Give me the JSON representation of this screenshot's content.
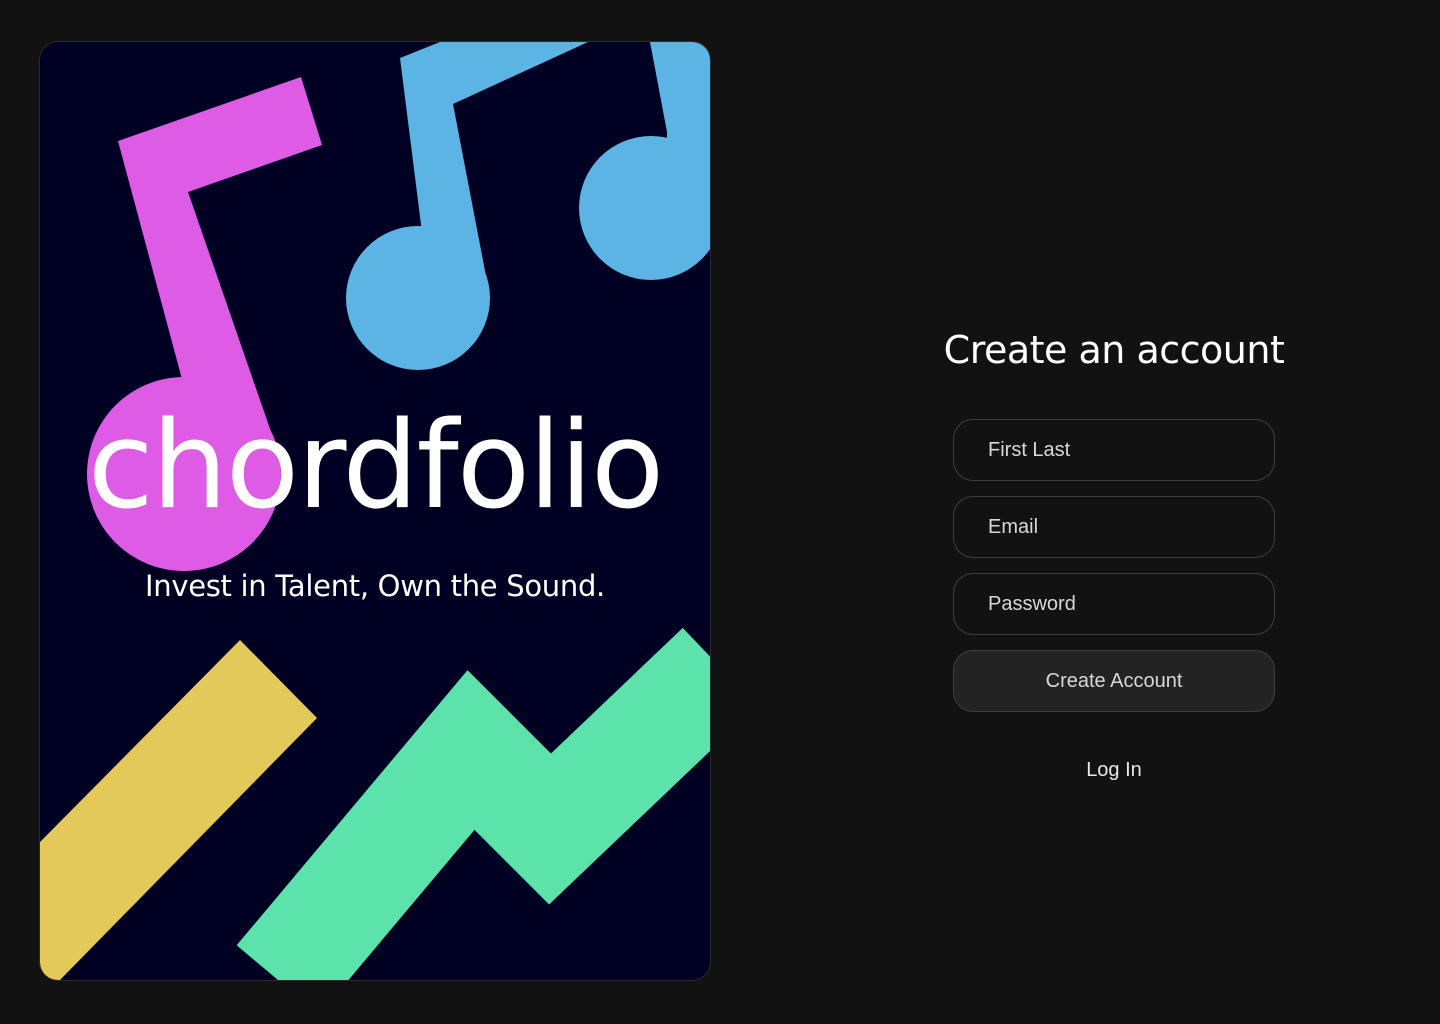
{
  "brand": {
    "logo_text": "chordfolio",
    "tagline": "Invest in Talent, Own the Sound.",
    "colors": {
      "background": "#000022",
      "note_pink": "#DE5BE6",
      "note_blue": "#5BB4E3",
      "bar_yellow": "#E2C95A",
      "zigzag_green": "#5CE3AB"
    }
  },
  "form": {
    "title": "Create an account",
    "name_placeholder": "First Last",
    "email_placeholder": "Email",
    "password_placeholder": "Password",
    "submit_label": "Create Account",
    "login_label": "Log In"
  }
}
